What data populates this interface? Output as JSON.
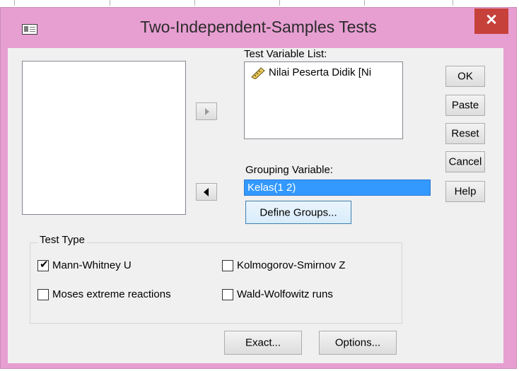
{
  "window": {
    "title": "Two-Independent-Samples Tests"
  },
  "labels": {
    "test_variable_list": "Test Variable List:",
    "grouping_variable": "Grouping Variable:",
    "test_type": "Test Type"
  },
  "test_variables": [
    {
      "name": "Nilai Peserta Didik  [Ni",
      "icon": "scale-ruler-icon"
    }
  ],
  "grouping_variable_value": "Kelas(1 2)",
  "buttons": {
    "ok": "OK",
    "paste": "Paste",
    "reset": "Reset",
    "cancel": "Cancel",
    "help": "Help",
    "define_groups": "Define Groups...",
    "exact": "Exact...",
    "options": "Options..."
  },
  "test_types": {
    "mann_whitney": {
      "label": "Mann-Whitney U",
      "checked": true
    },
    "kolmogorov": {
      "label": "Kolmogorov-Smirnov Z",
      "checked": false
    },
    "moses": {
      "label": "Moses extreme reactions",
      "checked": false
    },
    "wald": {
      "label": "Wald-Wolfowitz runs",
      "checked": false
    }
  },
  "colors": {
    "window_frame": "#e79fd2",
    "close_button": "#c7413b",
    "selection": "#3399ff",
    "client": "#f0f0f0"
  }
}
